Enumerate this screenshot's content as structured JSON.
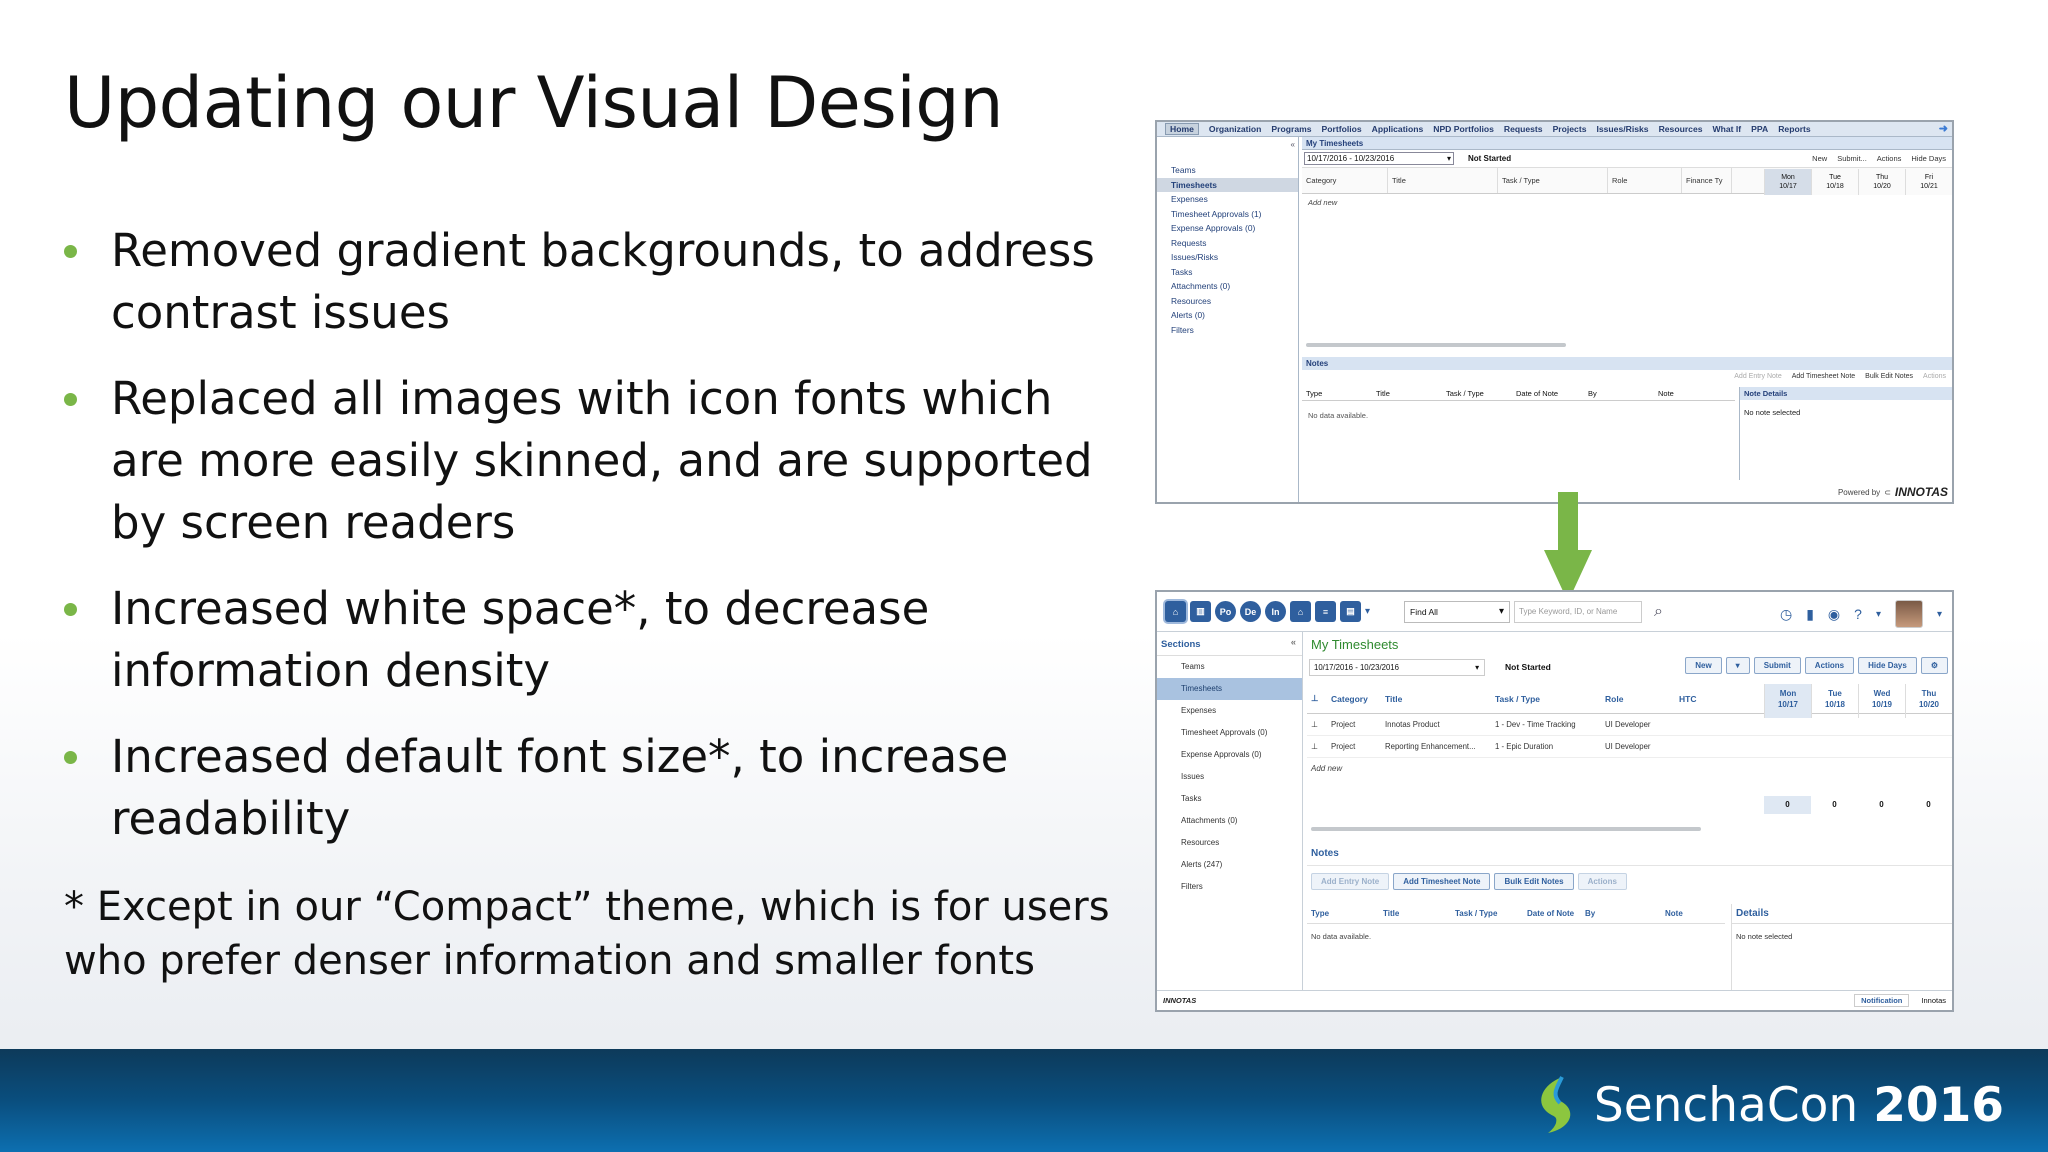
{
  "slide": {
    "title": "Updating our Visual Design",
    "bullets": [
      "Removed gradient backgrounds, to address contrast issues",
      "Replaced all images with icon fonts which are more easily skinned, and are supported by screen readers",
      "Increased white space*, to decrease information density",
      "Increased default font size*, to increase readability"
    ],
    "footnote": "* Except in our “Compact” theme, which is for users who prefer denser information and smaller fonts",
    "brand": {
      "name": "SenchaCon",
      "year": "2016"
    },
    "colors": {
      "bullet": "#7ab648",
      "arrow": "#7ab648",
      "band": "#0a4e7e"
    }
  },
  "old_ui": {
    "nav": [
      "Home",
      "Organization",
      "Programs",
      "Portfolios",
      "Applications",
      "NPD Portfolios",
      "Requests",
      "Projects",
      "Issues/Risks",
      "Resources",
      "What If",
      "PPA",
      "Reports"
    ],
    "sidebar": [
      "Teams",
      "Timesheets",
      "Expenses",
      "Timesheet Approvals (1)",
      "Expense Approvals (0)",
      "Requests",
      "Issues/Risks",
      "Tasks",
      "Attachments (0)",
      "Resources",
      "Alerts (0)",
      "Filters"
    ],
    "panel_title": "My Timesheets",
    "date_range": "10/17/2016 - 10/23/2016",
    "status": "Not Started",
    "actions": [
      "New",
      "Submit...",
      "Actions",
      "Hide Days"
    ],
    "columns": [
      "Category",
      "Title",
      "Task / Type",
      "Role",
      "Finance Ty"
    ],
    "days": [
      [
        "Mon",
        "10/17"
      ],
      [
        "Tue",
        "10/18"
      ],
      [
        "Thu",
        "10/20"
      ],
      [
        "Fri",
        "10/21"
      ]
    ],
    "add_new": "Add new",
    "notes_title": "Notes",
    "notes_actions": [
      "Add Entry Note",
      "Add Timesheet Note",
      "Bulk Edit Notes",
      "Actions"
    ],
    "notes_columns": [
      "Type",
      "Title",
      "Task / Type",
      "Date of Note",
      "By",
      "Note"
    ],
    "no_data": "No data available.",
    "details_title": "Note Details",
    "details_text": "No note selected",
    "powered_by": "Powered by",
    "powered_brand": "INNOTAS"
  },
  "new_ui": {
    "icons": [
      "home-icon",
      "building-icon",
      "Po",
      "De",
      "In",
      "bank-icon",
      "list-icon",
      "book-icon"
    ],
    "find": "Find All",
    "search_placeholder": "Type Keyword, ID, or Name",
    "sidebar_title": "Sections",
    "sidebar": [
      "Teams",
      "Timesheets",
      "Expenses",
      "Timesheet Approvals (0)",
      "Expense Approvals (0)",
      "Issues",
      "Tasks",
      "Attachments (0)",
      "Resources",
      "Alerts (247)",
      "Filters"
    ],
    "panel_title": "My Timesheets",
    "date_range": "10/17/2016 - 10/23/2016",
    "status": "Not Started",
    "buttons": [
      "New",
      "Submit",
      "Actions",
      "Hide Days"
    ],
    "columns": [
      "Category",
      "Title",
      "Task / Type",
      "Role",
      "HTC"
    ],
    "days": [
      [
        "Mon",
        "10/17"
      ],
      [
        "Tue",
        "10/18"
      ],
      [
        "Wed",
        "10/19"
      ],
      [
        "Thu",
        "10/20"
      ]
    ],
    "rows": [
      [
        "Project",
        "Innotas Product",
        "1 - Dev - Time Tracking",
        "UI Developer"
      ],
      [
        "Project",
        "Reporting Enhancement...",
        "1 - Epic Duration",
        "UI Developer"
      ]
    ],
    "add_new": "Add new",
    "totals": [
      "0",
      "0",
      "0",
      "0"
    ],
    "notes_title": "Notes",
    "notes_buttons": [
      "Add Entry Note",
      "Add Timesheet Note",
      "Bulk Edit Notes",
      "Actions"
    ],
    "notes_columns": [
      "Type",
      "Title",
      "Task / Type",
      "Date of Note",
      "By",
      "Note"
    ],
    "no_data": "No data available.",
    "details_title": "Details",
    "details_text": "No note selected",
    "footer_brand": "INNOTAS",
    "notification": "Notification",
    "footer_right": "Innotas"
  }
}
